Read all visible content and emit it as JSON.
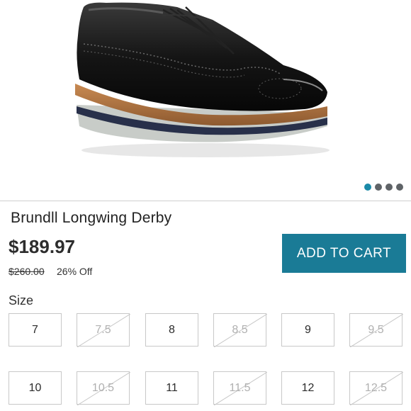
{
  "product": {
    "title": "Brundll Longwing Derby",
    "price": "$189.97",
    "original_price": "$260.00",
    "discount": "26% Off"
  },
  "actions": {
    "add_to_cart_label": "ADD TO CART"
  },
  "gallery": {
    "image_count": 4,
    "active_index": 0,
    "image_icon": "shoe-image"
  },
  "sizes": {
    "label": "Size",
    "row1": [
      {
        "label": "7",
        "available": true
      },
      {
        "label": "7.5",
        "available": false
      },
      {
        "label": "8",
        "available": true
      },
      {
        "label": "8.5",
        "available": false
      },
      {
        "label": "9",
        "available": true
      },
      {
        "label": "9.5",
        "available": false
      }
    ],
    "row2": [
      {
        "label": "10",
        "available": true
      },
      {
        "label": "10.5",
        "available": false
      },
      {
        "label": "11",
        "available": true
      },
      {
        "label": "11.5",
        "available": false
      },
      {
        "label": "12",
        "available": true
      },
      {
        "label": "12.5",
        "available": false
      }
    ]
  },
  "colors": {
    "accent": "#1a7b96",
    "active_dot": "#1a8aa8"
  }
}
